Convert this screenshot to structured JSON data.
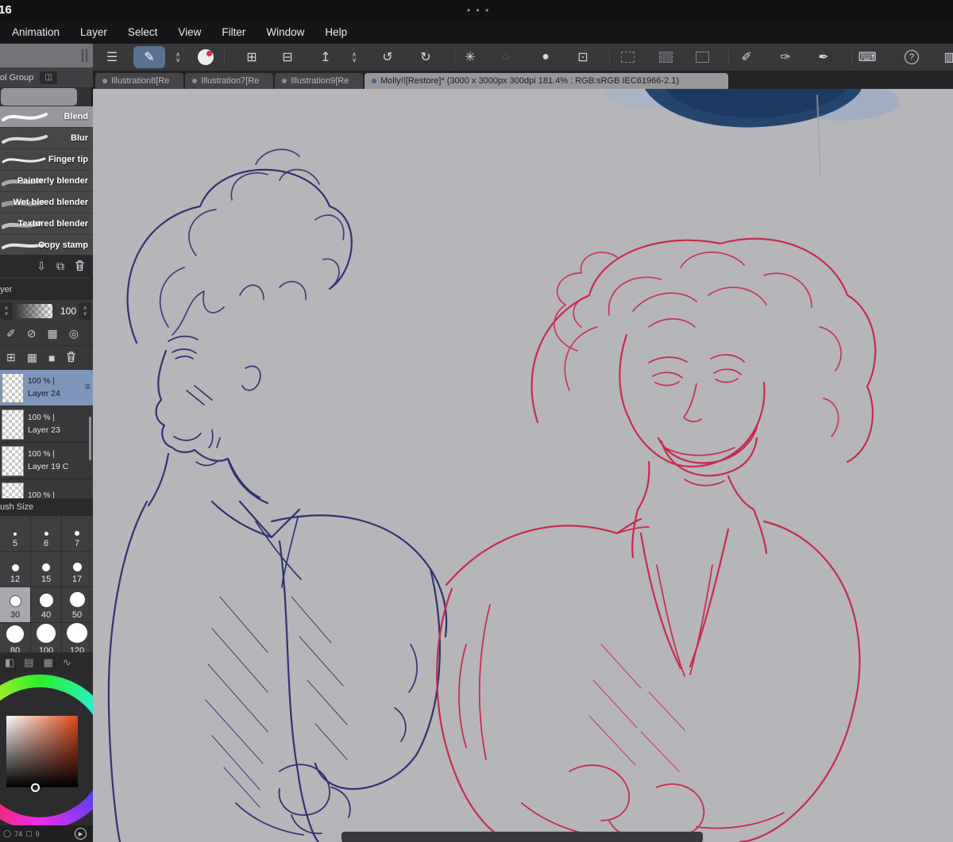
{
  "status_bar": {
    "time": "16",
    "dots": "• • •"
  },
  "menu_bar": {
    "items": [
      "Animation",
      "Layer",
      "Select",
      "View",
      "Filter",
      "Window",
      "Help"
    ]
  },
  "tabs": {
    "items": [
      {
        "label": "Illustration8[Re"
      },
      {
        "label": "Illustration7[Re"
      },
      {
        "label": "Illustration9[Re"
      }
    ],
    "active": {
      "label": "Molly!![Restore]* (3000 x 3000px 300dpi 181.4% : RGB:sRGB IEC61966-2.1)"
    }
  },
  "tool_panel": {
    "header": "ol Group"
  },
  "subtools": {
    "selected": "Blend",
    "items": [
      "Blend",
      "Blur",
      "Finger tip",
      "Painterly blender",
      "Wet bleed blender",
      "Textured blender",
      "Copy stamp"
    ]
  },
  "layer_panel": {
    "header": "yer",
    "opacity_value": "100",
    "selected": "Layer 24",
    "layers": [
      {
        "opacity": "100 %",
        "name": "Layer 24"
      },
      {
        "opacity": "100 %",
        "name": "Layer 23"
      },
      {
        "opacity": "100 %",
        "name": "Layer 19 C"
      },
      {
        "opacity": "100 %",
        "name": ""
      }
    ]
  },
  "brush_size": {
    "header": "ush Size",
    "selected": "30",
    "sizes": [
      "5",
      "6",
      "7",
      "12",
      "15",
      "17",
      "30",
      "40",
      "50",
      "80",
      "100",
      "120"
    ]
  },
  "status_strip": {
    "value_left": "74",
    "value_right": "9"
  },
  "icons": {
    "menu": "☰",
    "pen": "✎",
    "up": "∧",
    "down": "∨",
    "new_canvas": "⊞",
    "open_folder": "⊟",
    "export": "↥",
    "undo": "↺",
    "redo": "↻",
    "spinner": "✳",
    "dotted_circle": "◌",
    "blob": "●",
    "transform": "⊡",
    "polyline": "✐",
    "brush": "✑",
    "slant_pen": "✒",
    "keyboard": "⌨",
    "help": "?",
    "partial": "▥",
    "import": "⇩",
    "duplicate": "⧉",
    "layer_pen": "✐",
    "layer_lock": "⊘",
    "layer_checker": "▦",
    "layer_alpha": "◎",
    "layer_new": "⊞",
    "layer_grid": "▦",
    "layer_fill": "■",
    "layer_blend": "|",
    "handle": "≡",
    "grad_sq": "◧",
    "tone_sq": "▤",
    "grid_sq": "▦",
    "curve": "∿",
    "panel_toggle": "◫",
    "play": "▶",
    "circle_small": "◯",
    "square_small": "▢"
  },
  "colors": {
    "canvas_bg": "#b6b5ba",
    "sketch_blue": "#31336f",
    "sketch_red": "#c62b4b",
    "blob_navy": "#24456e",
    "sv_hue": "#e0481a",
    "selected_layer_bg": "#7e96ba",
    "active_tool_bg": "#5a7191"
  }
}
